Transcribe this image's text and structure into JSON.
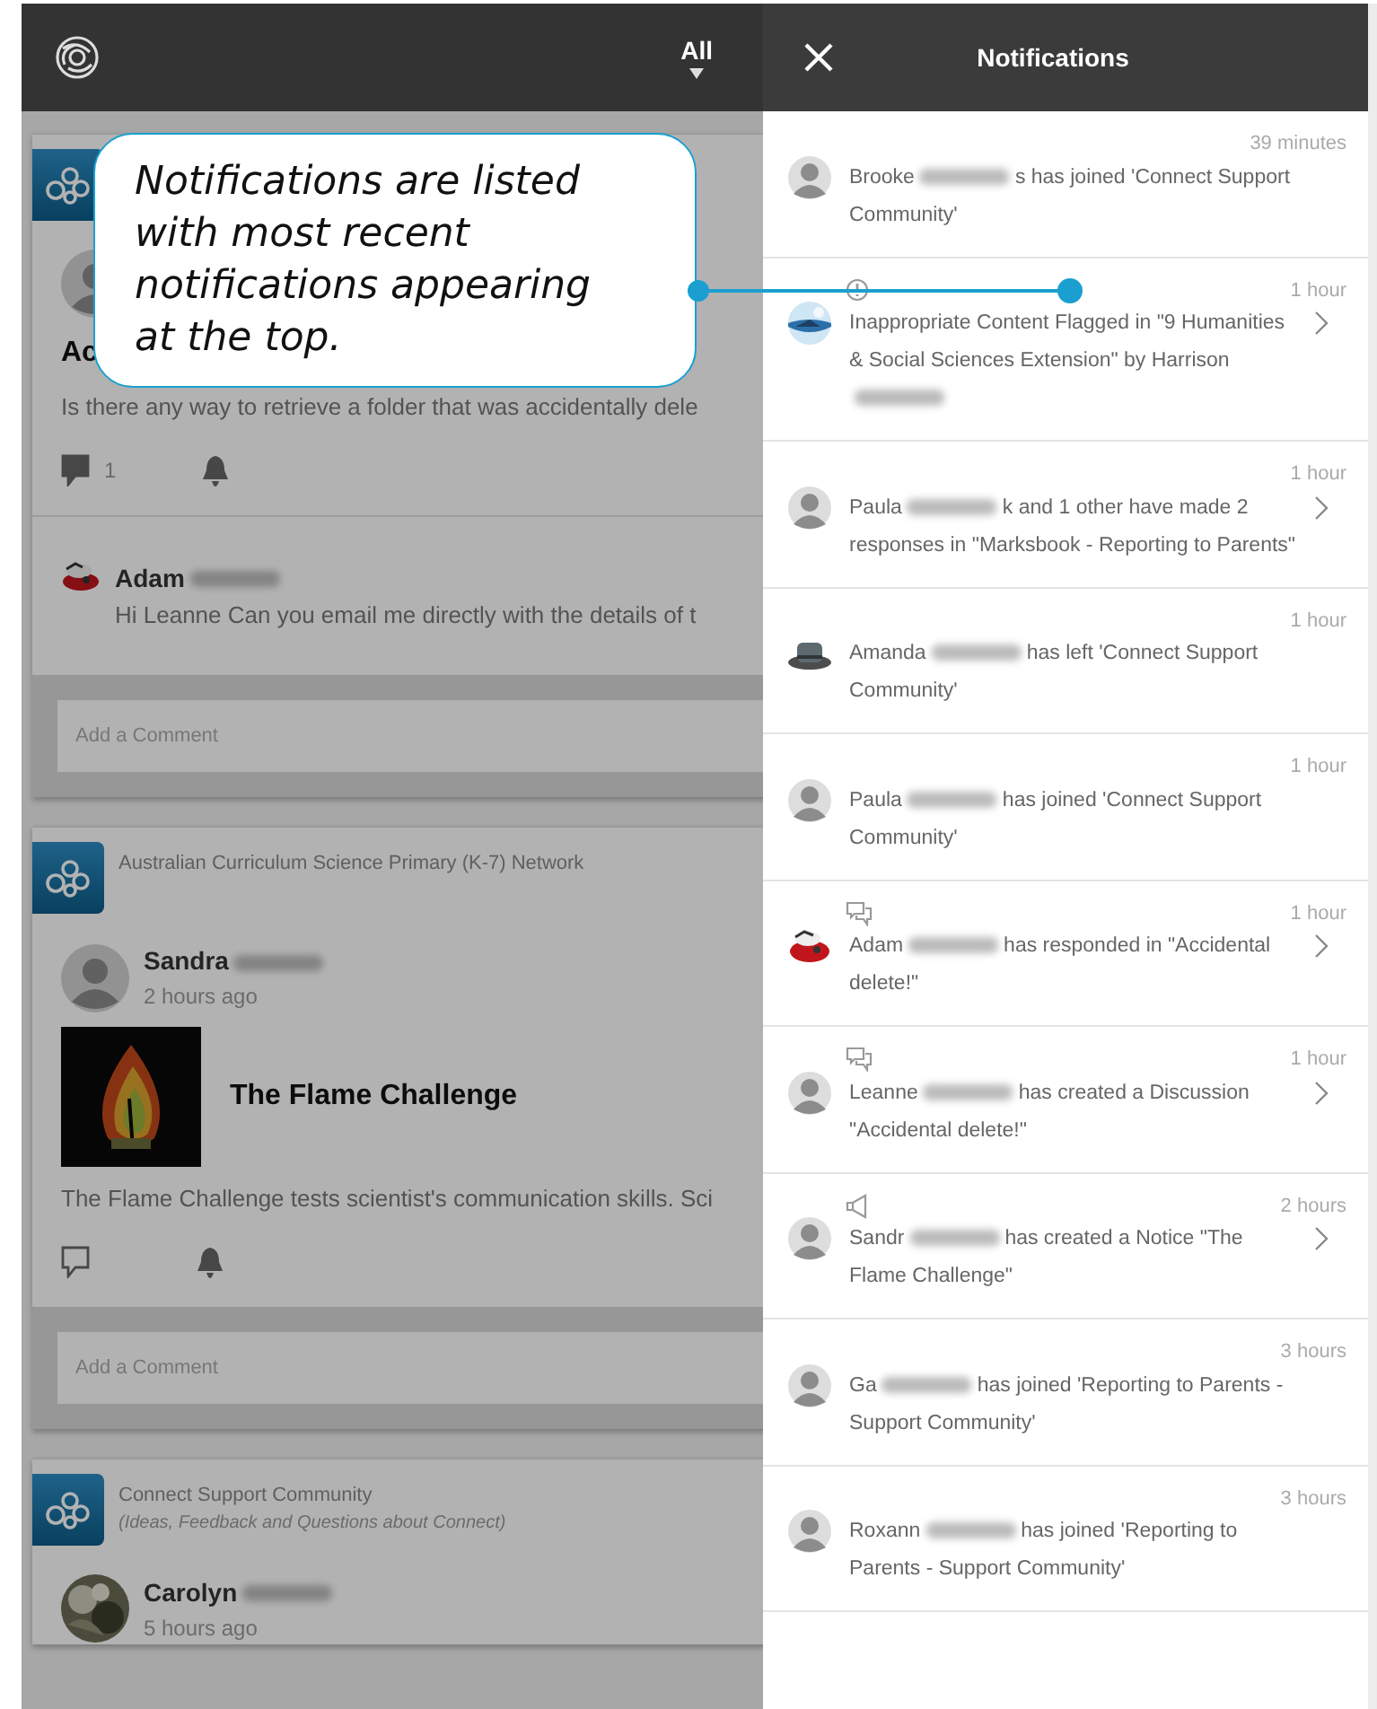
{
  "top_bar": {
    "filter": "All"
  },
  "posts": [
    {
      "kind": "discussion",
      "title": "Ac",
      "excerpt": "Is there any way to retrieve a folder that was accidentally dele",
      "comment_count": "1",
      "comment": {
        "author": "Adam",
        "text": "Hi Leanne Can you email me directly with the details of t"
      },
      "comment_placeholder": "Add a Comment"
    },
    {
      "kind": "notice",
      "community": "Australian Curriculum Science Primary (K-7) Network",
      "author": "Sandra",
      "time": "2 hours ago",
      "title": "The Flame Challenge",
      "excerpt": "The Flame Challenge tests scientist's communication skills. Sci",
      "comment_placeholder": "Add a Comment"
    },
    {
      "kind": "notice",
      "community": "Connect Support Community",
      "community_note": "(Ideas, Feedback and Questions about Connect)",
      "author": "Carolyn",
      "time": "5 hours ago"
    }
  ],
  "notifications_panel": {
    "title": "Notifications",
    "items": [
      {
        "avatar": {
          "kind": "person"
        },
        "kind": "plain",
        "text_before": "Brooke",
        "text_after": "s has joined 'Connect Support Community'",
        "time": "39 minutes",
        "link": false
      },
      {
        "avatar": {
          "kind": "globe"
        },
        "kind": "flag",
        "text_before": "Inappropriate Content Flagged in \"9 Humanities & Social Sciences Extension\" by Harrison",
        "time": "1 hour",
        "link": true
      },
      {
        "avatar": {
          "kind": "person"
        },
        "kind": "plain",
        "text_before": "Paula",
        "text_after": "k and 1 other have made 2 responses in \"Marksbook - Reporting to Parents\"",
        "time": "1 hour",
        "link": true
      },
      {
        "avatar": {
          "kind": "hat"
        },
        "kind": "plain",
        "text_before": "Amanda",
        "text_after": "has left 'Connect Support Community'",
        "time": "1 hour",
        "link": false
      },
      {
        "avatar": {
          "kind": "person"
        },
        "kind": "plain",
        "text_before": "Paula",
        "text_after": "has joined 'Connect Support Community'",
        "time": "1 hour",
        "link": false
      },
      {
        "avatar": {
          "kind": "mascot"
        },
        "kind": "discussion",
        "text_before": "Adam",
        "text_after": "has responded in \"Accidental delete!\"",
        "time": "1 hour",
        "link": true
      },
      {
        "avatar": {
          "kind": "person"
        },
        "kind": "discussion",
        "text_before": "Leanne",
        "text_after": "has created a Discussion \"Accidental delete!\"",
        "time": "1 hour",
        "link": true
      },
      {
        "avatar": {
          "kind": "person"
        },
        "kind": "notice",
        "text_before": "Sandr",
        "text_after": "has created a Notice \"The Flame Challenge\"",
        "time": "2 hours",
        "link": true
      },
      {
        "avatar": {
          "kind": "person"
        },
        "kind": "plain",
        "text_before": "Ga",
        "text_after": "has joined 'Reporting to Parents - Support Community'",
        "time": "3 hours",
        "link": false
      },
      {
        "avatar": {
          "kind": "person"
        },
        "kind": "plain",
        "text_before": "Roxann",
        "text_after": "has joined 'Reporting to Parents - Support Community'",
        "time": "3 hours",
        "link": false
      }
    ]
  },
  "callout": {
    "text": "Notifications are listed with most recent notifications appearing at the top."
  }
}
